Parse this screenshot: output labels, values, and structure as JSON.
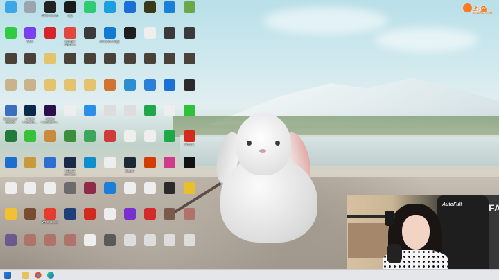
{
  "watermark": {
    "logo_text": "斗鱼",
    "logo_sub": "DOUYU.COM"
  },
  "webcam": {
    "chair_brand": "AutoFull",
    "background_letters": "FAM"
  },
  "colors": {
    "brand": "#ff6a00",
    "taskbar": "#e4e6ea"
  },
  "icons": [
    {
      "label": "",
      "icon": "pc-icon",
      "color": "#3aa7e8"
    },
    {
      "label": "",
      "icon": "wechat-icon",
      "color": "#2ecc40"
    },
    {
      "label": "",
      "icon": "folder-dark-icon",
      "color": "#4a4238"
    },
    {
      "label": "",
      "icon": "file-icon",
      "color": "#c9b38a"
    },
    {
      "label": "Wallpaper Engine",
      "icon": "wallpaper-engine-icon",
      "color": "#3a6fbf"
    },
    {
      "label": "",
      "icon": "app-icon",
      "color": "#1e7b3a"
    },
    {
      "label": "",
      "icon": "edge-old-icon",
      "color": "#1c6fd1"
    },
    {
      "label": "",
      "icon": "file-icon",
      "color": "#eeeeee"
    },
    {
      "label": "",
      "icon": "pinduoduo-icon",
      "color": "#f2c12e"
    },
    {
      "label": "",
      "icon": "game-icon",
      "color": "#6b5a8f"
    },
    {
      "label": "",
      "icon": "recycle-bin-icon",
      "color": "#9aa5ae"
    },
    {
      "label": "OBS",
      "icon": "obs-icon",
      "color": "#7b3ff2"
    },
    {
      "label": "",
      "icon": "folder-dark-icon",
      "color": "#4a4238"
    },
    {
      "label": "",
      "icon": "file-icon",
      "color": "#c9b38a"
    },
    {
      "label": "Adobe Photosh...",
      "icon": "photoshop-icon",
      "color": "#0a2a4a"
    },
    {
      "label": "",
      "icon": "iqiyi-icon",
      "color": "#35c236"
    },
    {
      "label": "",
      "icon": "game-icon",
      "color": "#c79a3a"
    },
    {
      "label": "",
      "icon": "file-icon",
      "color": "#eeeeee"
    },
    {
      "label": "",
      "icon": "app-icon",
      "color": "#7a4b2f"
    },
    {
      "label": "",
      "icon": "game-icon",
      "color": "#b0736a"
    },
    {
      "label": "OBS Studio",
      "icon": "obs-studio-icon",
      "color": "#222222"
    },
    {
      "label": "",
      "icon": "netease-music-icon",
      "color": "#d8232a"
    },
    {
      "label": "",
      "icon": "folder-icon",
      "color": "#e5c36a"
    },
    {
      "label": "",
      "icon": "folder-icon",
      "color": "#e5c36a"
    },
    {
      "label": "Adobe Premiere P...",
      "icon": "premiere-icon",
      "color": "#2a0f4a"
    },
    {
      "label": "",
      "icon": "app-icon",
      "color": "#c98a3a"
    },
    {
      "label": "",
      "icon": "app-icon",
      "color": "#2a6fd1"
    },
    {
      "label": "",
      "icon": "file-icon",
      "color": "#eeeeee"
    },
    {
      "label": "WPS Office",
      "icon": "wps-icon",
      "color": "#e63b2e"
    },
    {
      "label": "",
      "icon": "game-icon",
      "color": "#b0736a"
    },
    {
      "label": "QQ",
      "icon": "qq-icon",
      "color": "#1a1a1a"
    },
    {
      "label": "Google Chrome",
      "icon": "chrome-icon",
      "color": "#e4463b"
    },
    {
      "label": "",
      "icon": "folder-dark-icon",
      "color": "#4a4238"
    },
    {
      "label": "",
      "icon": "folder-icon",
      "color": "#e5c36a"
    },
    {
      "label": "",
      "icon": "file-icon",
      "color": "#eeeeee"
    },
    {
      "label": "",
      "icon": "app-icon",
      "color": "#3a8f3a"
    },
    {
      "label": "Ubisoft Connect",
      "icon": "ubisoft-icon",
      "color": "#1b2a4a"
    },
    {
      "label": "",
      "icon": "rh-icon",
      "color": "#6b6b6b"
    },
    {
      "label": "",
      "icon": "app-icon",
      "color": "#1f3f7a"
    },
    {
      "label": "",
      "icon": "game-icon",
      "color": "#b0736a"
    },
    {
      "label": "",
      "icon": "app-icon",
      "color": "#2ecc71"
    },
    {
      "label": "",
      "icon": "game-icon",
      "color": "#3a3a3a"
    },
    {
      "label": "",
      "icon": "folder-dark-icon",
      "color": "#4a4238"
    },
    {
      "label": "",
      "icon": "folder-icon",
      "color": "#e5c36a"
    },
    {
      "label": "",
      "icon": "app-icon",
      "color": "#2a8fe8"
    },
    {
      "label": "",
      "icon": "app-icon",
      "color": "#3aa75a"
    },
    {
      "label": "",
      "icon": "app-icon",
      "color": "#0a8fd1"
    },
    {
      "label": "",
      "icon": "game-icon",
      "color": "#8f2a4a"
    },
    {
      "label": "",
      "icon": "noi-icon",
      "color": "#d42a1e"
    },
    {
      "label": "",
      "icon": "file-icon",
      "color": "#eeeeee"
    },
    {
      "label": "",
      "icon": "app-icon",
      "color": "#1a9fe0"
    },
    {
      "label": "Microsoft Edge",
      "icon": "edge-icon",
      "color": "#0f7bd1"
    },
    {
      "label": "",
      "icon": "folder-dark-icon",
      "color": "#4a4238"
    },
    {
      "label": "",
      "icon": "app-icon",
      "color": "#d1732a"
    },
    {
      "label": "",
      "icon": "file-icon",
      "color": "#dddddd"
    },
    {
      "label": "",
      "icon": "app-icon",
      "color": "#d13a3a"
    },
    {
      "label": "",
      "icon": "file-icon",
      "color": "#eeeeee"
    },
    {
      "label": "",
      "icon": "kugou-icon",
      "color": "#1a7fd8"
    },
    {
      "label": "",
      "icon": "file-icon",
      "color": "#eeeeee"
    },
    {
      "label": "",
      "icon": "app-icon",
      "color": "#5a5a5a"
    },
    {
      "label": "",
      "icon": "app-icon",
      "color": "#1a6fd8"
    },
    {
      "label": "",
      "icon": "app-icon",
      "color": "#1e1e1e"
    },
    {
      "label": "",
      "icon": "folder-dark-icon",
      "color": "#4a4238"
    },
    {
      "label": "",
      "icon": "app-icon",
      "color": "#2a8fd1"
    },
    {
      "label": "",
      "icon": "file-icon",
      "color": "#dddddd"
    },
    {
      "label": "",
      "icon": "file-icon",
      "color": "#eeeeee"
    },
    {
      "label": "Steam",
      "icon": "steam-icon",
      "color": "#1b2838"
    },
    {
      "label": "",
      "icon": "file-icon",
      "color": "#eeeeee"
    },
    {
      "label": "",
      "icon": "app-icon",
      "color": "#7a2fd1"
    },
    {
      "label": "",
      "icon": "file-icon",
      "color": "#dddddd"
    },
    {
      "label": "",
      "icon": "app-icon",
      "color": "#3a3a1a"
    },
    {
      "label": "",
      "icon": "file-icon",
      "color": "#eeeeee"
    },
    {
      "label": "",
      "icon": "folder-dark-icon",
      "color": "#4a4238"
    },
    {
      "label": "",
      "icon": "app-icon",
      "color": "#2a7fd8"
    },
    {
      "label": "",
      "icon": "app-icon",
      "color": "#1fa84a"
    },
    {
      "label": "",
      "icon": "file-icon",
      "color": "#eeeeee"
    },
    {
      "label": "",
      "icon": "office-icon",
      "color": "#d83b01"
    },
    {
      "label": "",
      "icon": "file-icon",
      "color": "#eeeeee"
    },
    {
      "label": "",
      "icon": "angry-birds-icon",
      "color": "#d42a2a"
    },
    {
      "label": "",
      "icon": "file-icon",
      "color": "#dddddd"
    },
    {
      "label": "",
      "icon": "app-icon",
      "color": "#1a7fd8"
    },
    {
      "label": "",
      "icon": "app-icon",
      "color": "#3a3a3a"
    },
    {
      "label": "",
      "icon": "folder-dark-icon",
      "color": "#4a4238"
    },
    {
      "label": "",
      "icon": "app-icon",
      "color": "#1a6fd8"
    },
    {
      "label": "",
      "icon": "file-icon",
      "color": "#eeeeee"
    },
    {
      "label": "",
      "icon": "app-icon",
      "color": "#1fa84a"
    },
    {
      "label": "",
      "icon": "app-icon",
      "color": "#d13a8a"
    },
    {
      "label": "",
      "icon": "typora-icon",
      "color": "#2a2a2a"
    },
    {
      "label": "",
      "icon": "game-icon",
      "color": "#7a5a4a"
    },
    {
      "label": "",
      "icon": "file-icon",
      "color": "#dddddd"
    },
    {
      "label": "",
      "icon": "app-icon",
      "color": "#6aa84a"
    },
    {
      "label": "",
      "icon": "app-icon",
      "color": "#3a3a3a"
    },
    {
      "label": "",
      "icon": "folder-dark-icon",
      "color": "#4a4238"
    },
    {
      "label": "",
      "icon": "app-icon",
      "color": "#2a2a2a"
    },
    {
      "label": "",
      "icon": "app-icon",
      "color": "#2ec23a"
    },
    {
      "label": "VOICE",
      "icon": "voice-icon",
      "color": "#d42a1e"
    },
    {
      "label": "",
      "icon": "qr-icon",
      "color": "#111111"
    },
    {
      "label": "",
      "icon": "app-icon",
      "color": "#e8c02a"
    },
    {
      "label": "",
      "icon": "game-icon",
      "color": "#b0736a"
    },
    {
      "label": "",
      "icon": "file-icon",
      "color": "#dddddd"
    }
  ],
  "taskbar": {
    "items": [
      "start-icon",
      "folder-icon",
      "chrome-icon",
      "edge-icon"
    ]
  }
}
